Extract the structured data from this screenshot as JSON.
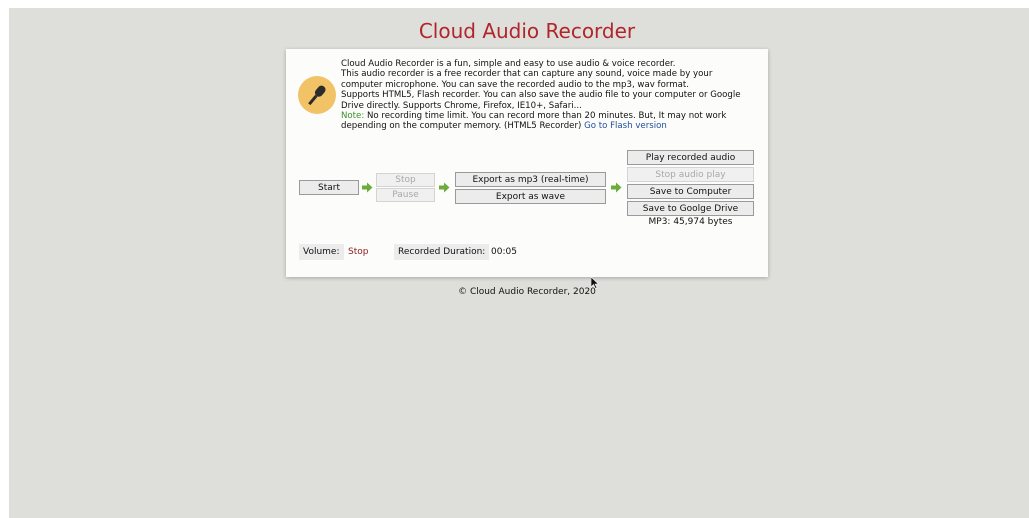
{
  "app": {
    "title": "Cloud Audio Recorder",
    "footer": "© Cloud Audio Recorder, 2020"
  },
  "intro": {
    "line1": "Cloud Audio Recorder is a fun, simple and easy to use audio & voice recorder.",
    "line2": "This audio recorder is a free recorder that can capture any sound, voice made by your",
    "line3": "computer microphone. You can save the recorded audio to the mp3, wav format.",
    "line4": "Supports HTML5, Flash recorder. You can also save the audio file to your computer or Google",
    "line5": "Drive directly. Supports Chrome, Firefox, IE10+, Safari...",
    "note_label": "Note:",
    "note_text": " No recording time limit. You can record more than 20 minutes. But, It may not work",
    "line7": "depending on the computer memory. (HTML5 Recorder) ",
    "flash_link": "Go to Flash version"
  },
  "controls": {
    "start": "Start",
    "stop": "Stop",
    "pause": "Pause",
    "export_mp3": "Export as mp3 (real-time)",
    "export_wave": "Export as wave",
    "play_recorded": "Play recorded audio",
    "stop_audio": "Stop audio play",
    "save_computer": "Save to Computer",
    "save_drive": "Save to Goolge Drive",
    "file_info": "MP3: 45,974 bytes"
  },
  "status": {
    "volume_label": "Volume:",
    "volume_value": "Stop",
    "duration_label": "Recorded Duration:",
    "duration_value": "00:05"
  },
  "colors": {
    "title": "#b0262a",
    "arrow": "#6cab3c",
    "note": "#3a8f2a",
    "link": "#1f4fa0",
    "volume_stop": "#8b1c1c",
    "mic_badge": "#f1c266"
  },
  "icons": [
    "microphone-icon",
    "arrow-right-icon",
    "cursor-icon"
  ]
}
